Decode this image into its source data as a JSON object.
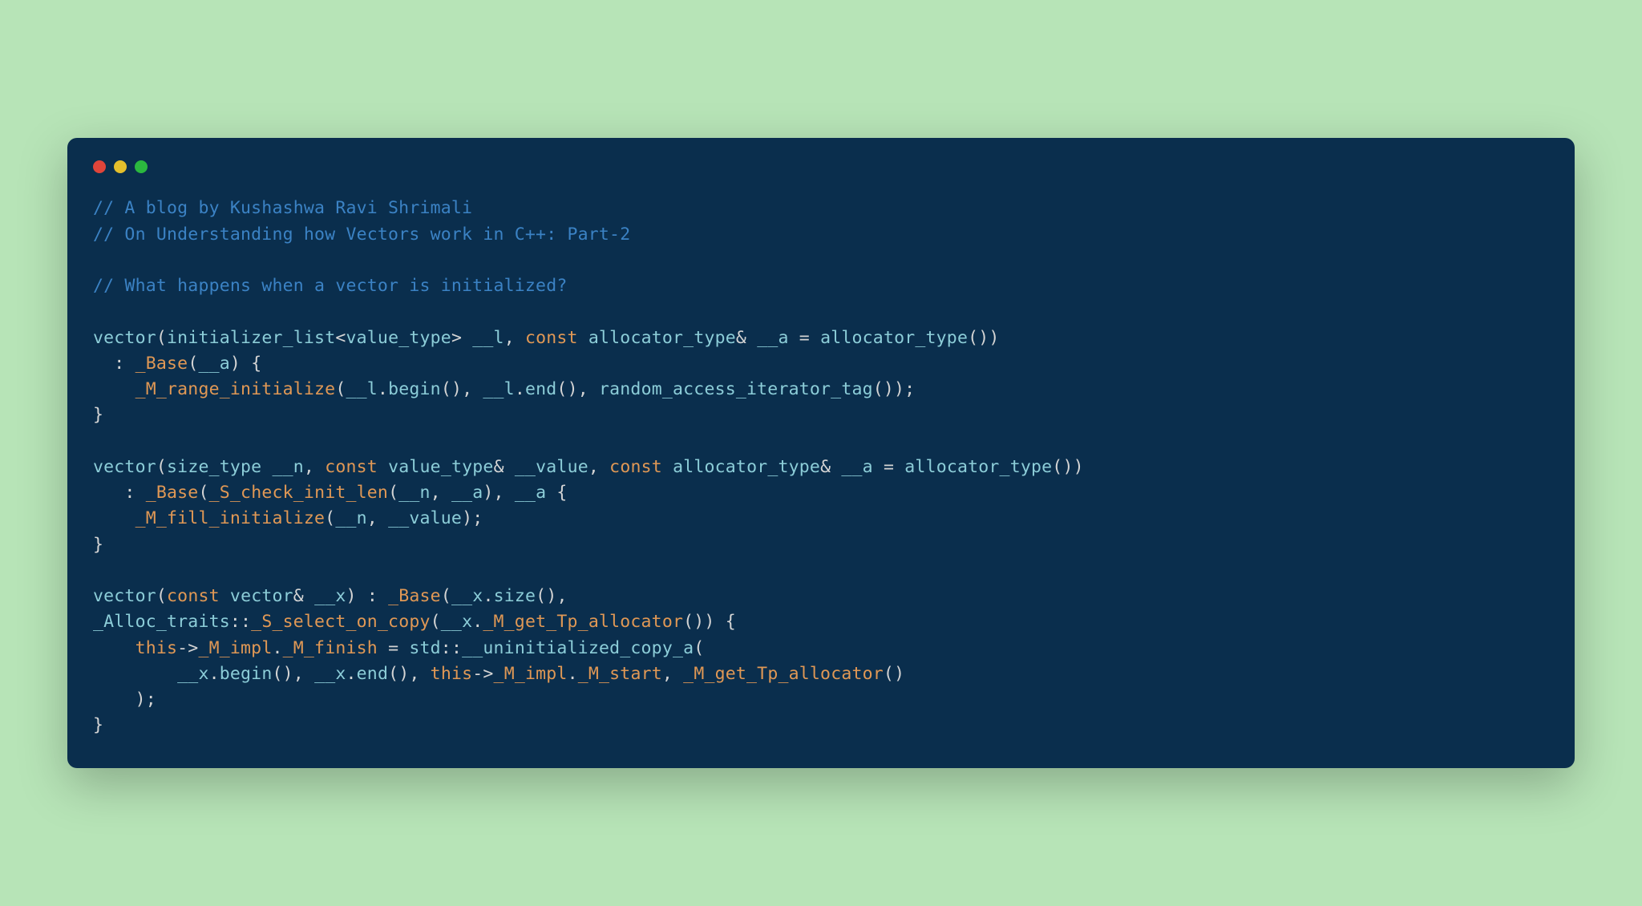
{
  "comments": {
    "line1": "// A blog by Kushashwa Ravi Shrimali",
    "line2": "// On Understanding how Vectors work in C++: Part-2",
    "line3": "// What happens when a vector is initialized?"
  },
  "code": {
    "l5_vector": "vector",
    "l5_open": "(",
    "l5_initlist": "initializer_list",
    "l5_lt": "<",
    "l5_valtype": "value_type",
    "l5_gt": "> ",
    "l5_l": "__l",
    "l5_comma": ", ",
    "l5_const": "const",
    "l5_sp": " ",
    "l5_alloctype": "allocator_type",
    "l5_amp": "& ",
    "l5_a": "__a",
    "l5_eq": " = ",
    "l5_alloctype2": "allocator_type",
    "l5_close": "())",
    "l6_indent": "  : ",
    "l6_base": "_Base",
    "l6_open": "(",
    "l6_a": "__a",
    "l6_close": ") {",
    "l7_indent": "    ",
    "l7_mrange": "_M_range_initialize",
    "l7_open": "(",
    "l7_l": "__l",
    "l7_dot1": ".",
    "l7_begin": "begin",
    "l7_p1": "(), ",
    "l7_l2": "__l",
    "l7_dot2": ".",
    "l7_end": "end",
    "l7_p2": "(), ",
    "l7_rait": "random_access_iterator_tag",
    "l7_close": "());",
    "l8": "}",
    "l10_vector": "vector",
    "l10_open": "(",
    "l10_sizetype": "size_type",
    "l10_sp1": " ",
    "l10_n": "__n",
    "l10_comma1": ", ",
    "l10_const1": "const",
    "l10_sp2": " ",
    "l10_valtype": "value_type",
    "l10_amp1": "& ",
    "l10_value": "__value",
    "l10_comma2": ", ",
    "l10_const2": "const",
    "l10_sp3": " ",
    "l10_alloctype": "allocator_type",
    "l10_amp2": "& ",
    "l10_a": "__a",
    "l10_eq": " = ",
    "l10_alloctype2": "allocator_type",
    "l10_close": "())",
    "l11_indent": "   : ",
    "l11_base": "_Base",
    "l11_open": "(",
    "l11_scheck": "_S_check_init_len",
    "l11_open2": "(",
    "l11_n": "__n",
    "l11_comma": ", ",
    "l11_a": "__a",
    "l11_close": "), ",
    "l11_a2": "__a",
    "l11_brace": " {",
    "l12_indent": "    ",
    "l12_mfill": "_M_fill_initialize",
    "l12_open": "(",
    "l12_n": "__n",
    "l12_comma": ", ",
    "l12_value": "__value",
    "l12_close": ");",
    "l13": "}",
    "l15_vector": "vector",
    "l15_open": "(",
    "l15_const": "const",
    "l15_sp": " ",
    "l15_vec": "vector",
    "l15_amp": "& ",
    "l15_x": "__x",
    "l15_close": ") : ",
    "l15_base": "_Base",
    "l15_open2": "(",
    "l15_x2": "__x",
    "l15_dot": ".",
    "l15_size": "size",
    "l15_end": "(),",
    "l16_alloc": "_Alloc_traits",
    "l16_colon": "::",
    "l16_sselect": "_S_select_on_copy",
    "l16_open": "(",
    "l16_x": "__x",
    "l16_dot": ".",
    "l16_mget": "_M_get_Tp_allocator",
    "l16_close": "()) {",
    "l17_indent": "    ",
    "l17_this": "this",
    "l17_arrow": "->",
    "l17_mimpl": "_M_impl",
    "l17_dot": ".",
    "l17_mfinish": "_M_finish",
    "l17_eq": " = ",
    "l17_std": "std",
    "l17_colon": "::",
    "l17_uninit": "__uninitialized_copy_a",
    "l17_open": "(",
    "l18_indent": "        ",
    "l18_x": "__x",
    "l18_dot1": ".",
    "l18_begin": "begin",
    "l18_p1": "(), ",
    "l18_x2": "__x",
    "l18_dot2": ".",
    "l18_end": "end",
    "l18_p2": "(), ",
    "l18_this": "this",
    "l18_arrow": "->",
    "l18_mimpl": "_M_impl",
    "l18_dot3": ".",
    "l18_mstart": "_M_start",
    "l18_comma": ", ",
    "l18_mget": "_M_get_Tp_allocator",
    "l18_close": "()",
    "l19_indent": "    ",
    "l19_close": ");",
    "l20": "}"
  }
}
